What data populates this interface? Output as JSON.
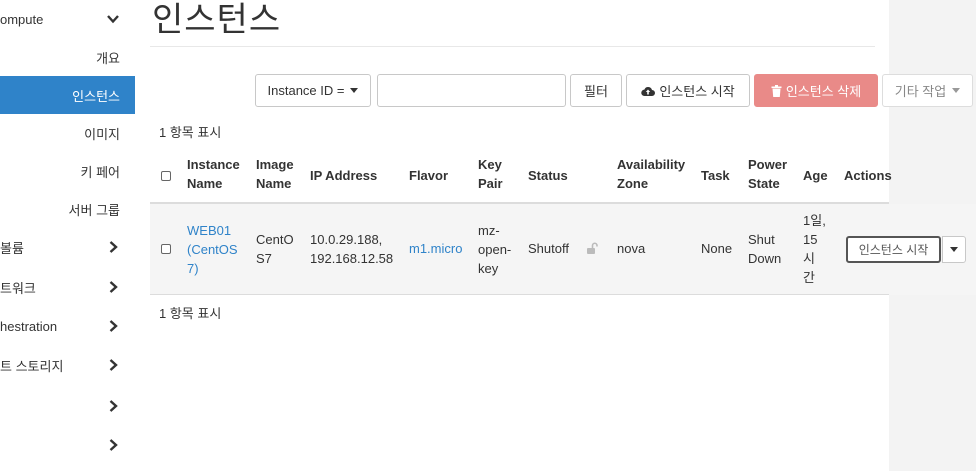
{
  "sidebar": {
    "items": [
      {
        "label": "ompute"
      },
      {
        "label": "개요"
      },
      {
        "label": "인스턴스"
      },
      {
        "label": "이미지"
      },
      {
        "label": "키 페어"
      },
      {
        "label": "서버 그룹"
      },
      {
        "label": "볼륨"
      },
      {
        "label": "트워크"
      },
      {
        "label": "hestration"
      },
      {
        "label": "트 스토리지"
      }
    ]
  },
  "page": {
    "title": "인스턴스"
  },
  "toolbar": {
    "filter_select": "Instance ID =",
    "filter_input_value": "",
    "filter_button": "필터",
    "launch_button": "인스턴스 시작",
    "delete_button": "인스턴스 삭제",
    "more_button": "기타 작업"
  },
  "summary": {
    "count_top": "1 항목 표시",
    "count_bottom": "1 항목 표시"
  },
  "table": {
    "headers": {
      "instance_name": [
        "Instance",
        "Name"
      ],
      "image_name": [
        "Image",
        "Name"
      ],
      "ip_address": "IP Address",
      "flavor": "Flavor",
      "key_pair": [
        "Key",
        "Pair"
      ],
      "status": "Status",
      "availability_zone": [
        "Availability",
        "Zone"
      ],
      "task": "Task",
      "power_state": [
        "Power",
        "State"
      ],
      "age": "Age",
      "actions": "Actions"
    },
    "rows": [
      {
        "instance_name": [
          "WEB01",
          "(CentOS",
          "7)"
        ],
        "image_name": [
          "CentO",
          "S7"
        ],
        "ip_address": [
          "10.0.29.188,",
          "192.168.12.58"
        ],
        "flavor": "m1.micro",
        "key_pair": [
          "mz-",
          "open-",
          "key"
        ],
        "status": "Shutoff",
        "availability_zone": "nova",
        "task": "None",
        "power_state": [
          "Shut",
          "Down"
        ],
        "age": [
          "1일,",
          "15",
          "시",
          "간"
        ],
        "action_label": "인스턴스 시작"
      }
    ]
  },
  "colors": {
    "accent": "#2f83c9",
    "danger": "#e98a88",
    "row_bg": "#f5f5f5"
  }
}
